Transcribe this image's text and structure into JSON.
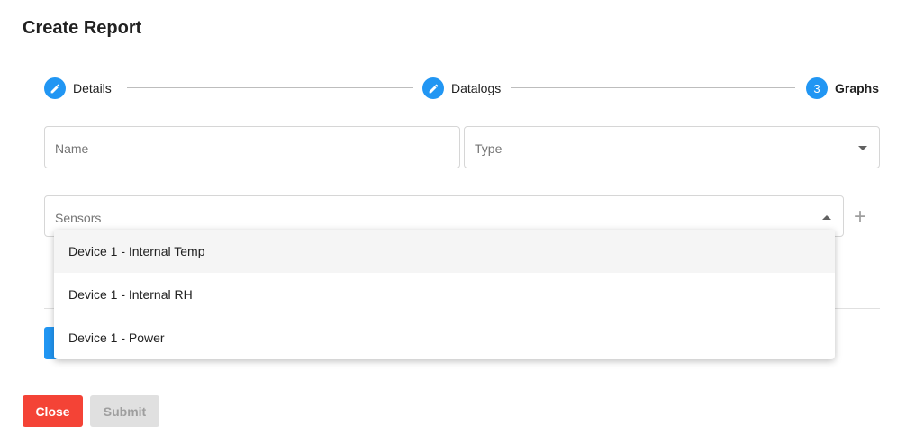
{
  "dialog": {
    "title": "Create Report"
  },
  "stepper": {
    "steps": [
      {
        "label": "Details",
        "state": "completed",
        "icon": "pencil-icon"
      },
      {
        "label": "Datalogs",
        "state": "completed",
        "icon": "pencil-icon"
      },
      {
        "label": "Graphs",
        "state": "active",
        "number": "3"
      }
    ]
  },
  "form": {
    "name_placeholder": "Name",
    "type_placeholder": "Type",
    "sensors_placeholder": "Sensors"
  },
  "sensor_menu": {
    "options": [
      "Device 1 - Internal Temp",
      "Device 1 - Internal RH",
      "Device 1 - Power"
    ]
  },
  "actions": {
    "close_label": "Close",
    "submit_label": "Submit"
  },
  "colors": {
    "primary": "#2196f3",
    "danger": "#f44336",
    "disabled": "#e0e0e0"
  }
}
